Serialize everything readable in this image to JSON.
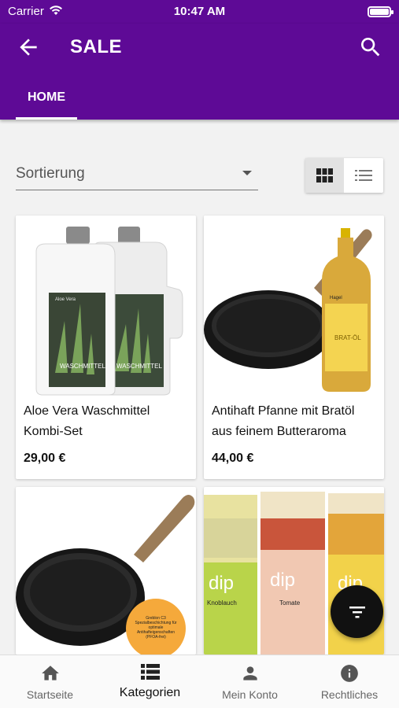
{
  "status_bar": {
    "carrier": "Carrier",
    "time": "10:47 AM"
  },
  "header": {
    "title": "SALE",
    "tabs": [
      {
        "label": "HOME",
        "active": true
      }
    ]
  },
  "sort": {
    "label": "Sortierung"
  },
  "view_modes": [
    "grid",
    "list"
  ],
  "active_view": "grid",
  "products": [
    {
      "name": "Aloe Vera Waschmittel Kombi-Set",
      "price": "29,00 €",
      "image_labels": [
        "Aloe Vera",
        "WASCHMITTEL",
        "WASCHMITTEL"
      ]
    },
    {
      "name": "Antihaft Pfanne mit Bratöl aus feinem Butteraroma",
      "price": "44,00 €",
      "image_labels": [
        "Hagel",
        "BRAT-ÖL"
      ]
    },
    {
      "name": "",
      "price": "",
      "image_labels": [
        "Greblon C3 Spezialbeschichtung für optimale Antihafteigenschaften (PFOA-frei)"
      ]
    },
    {
      "name": "",
      "price": "",
      "image_labels": [
        "dip",
        "Knoblauch",
        "dip",
        "Tomate",
        "dip"
      ]
    }
  ],
  "bottom_nav": [
    {
      "label": "Startseite",
      "icon": "home-icon"
    },
    {
      "label": "Kategorien",
      "icon": "list-icon",
      "active": true
    },
    {
      "label": "Mein Konto",
      "icon": "person-icon"
    },
    {
      "label": "Rechtliches",
      "icon": "info-icon"
    }
  ],
  "colors": {
    "primary": "#5e0a96",
    "background": "#f2f2f2",
    "fab": "#111111"
  }
}
